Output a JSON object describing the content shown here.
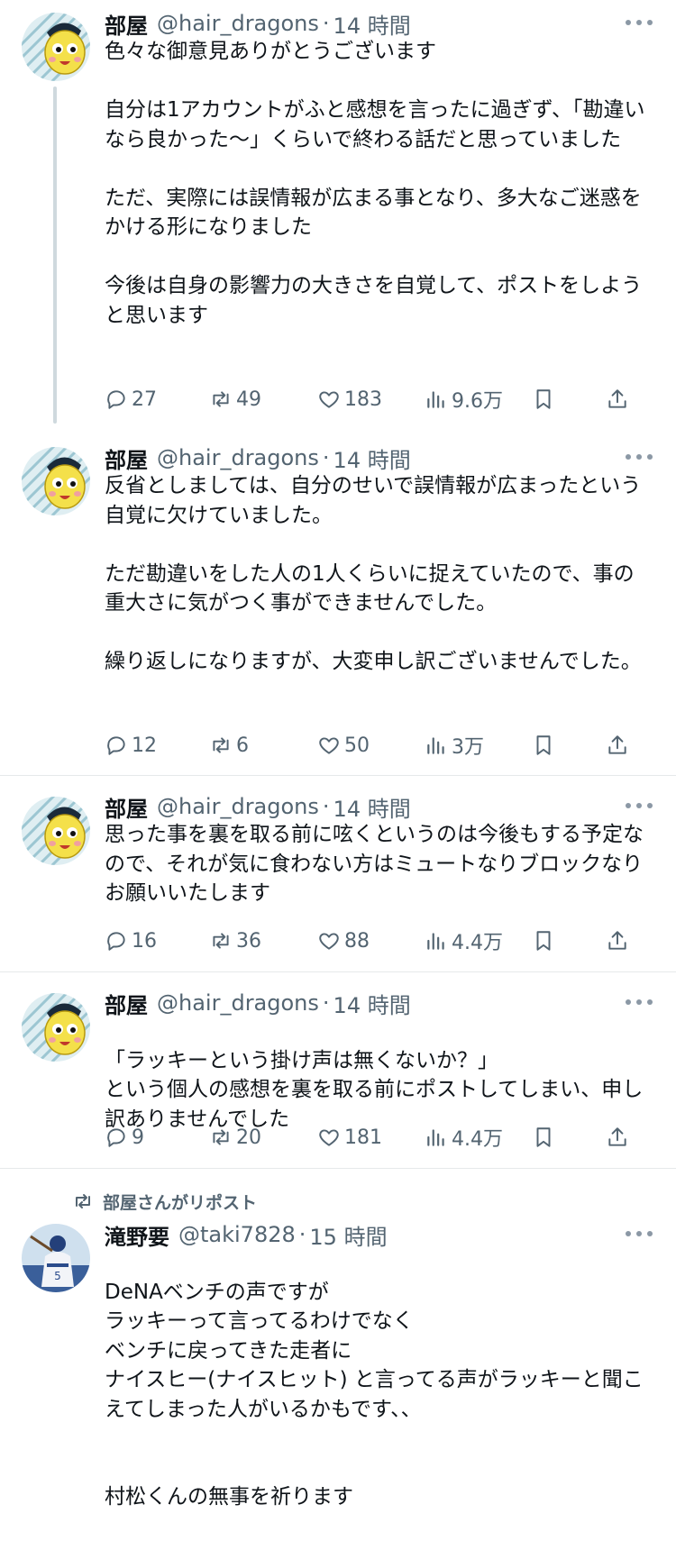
{
  "tweets": [
    {
      "name": "部屋",
      "handle": "@hair_dragons",
      "sep": "·",
      "time": "14 時間",
      "paragraphs": [
        "色々な御意見ありがとうございます",
        "自分は1アカウントがふと感想を言ったに過ぎず、「勘違いなら良かった〜」くらいで終わる話だと思っていました",
        "ただ、実際には誤情報が広まる事となり、多大なご迷惑をかける形になりました",
        "今後は自身の影響力の大きさを自覚して、ポストをしようと思います"
      ],
      "stats": {
        "replies": "27",
        "reposts": "49",
        "likes": "183",
        "views": "9.6万"
      }
    },
    {
      "name": "部屋",
      "handle": "@hair_dragons",
      "sep": "·",
      "time": "14 時間",
      "paragraphs": [
        "反省としましては、自分のせいで誤情報が広まったという自覚に欠けていました。",
        "ただ勘違いをした人の1人くらいに捉えていたので、事の重大さに気がつく事ができませんでした。",
        "繰り返しになりますが、大変申し訳ございませんでした。"
      ],
      "stats": {
        "replies": "12",
        "reposts": "6",
        "likes": "50",
        "views": "3万"
      }
    },
    {
      "name": "部屋",
      "handle": "@hair_dragons",
      "sep": "·",
      "time": "14 時間",
      "paragraphs": [
        "思った事を裏を取る前に呟くというのは今後もする予定なので、それが気に食わない方はミュートなりブロックなりお願いいたします"
      ],
      "stats": {
        "replies": "16",
        "reposts": "36",
        "likes": "88",
        "views": "4.4万"
      }
    },
    {
      "name": "部屋",
      "handle": "@hair_dragons",
      "sep": "·",
      "time": "14 時間",
      "paragraphs": [
        "「ラッキーという掛け声は無くないか？」\nという個人の感想を裏を取る前にポストしてしまい、申し訳ありませんでした"
      ],
      "stats": {
        "replies": "9",
        "reposts": "20",
        "likes": "181",
        "views": "4.4万"
      }
    }
  ],
  "repost": {
    "label": "部屋さんがリポスト",
    "name": "滝野要",
    "handle": "@taki7828",
    "sep": "·",
    "time": "15 時間",
    "paragraphs": [
      "DeNAベンチの声ですが\nラッキーって言ってるわけでなく\nベンチに戻ってきた走者に\nナイスヒー(ナイスヒット) と言ってる声がラッキーと聞こえてしまった人がいるかもです、、",
      "村松くんの無事を祈ります"
    ]
  },
  "colors": {
    "text": "#0f1419",
    "muted": "#536471",
    "divider": "#e6e9ea",
    "thread": "#cfd9de"
  }
}
